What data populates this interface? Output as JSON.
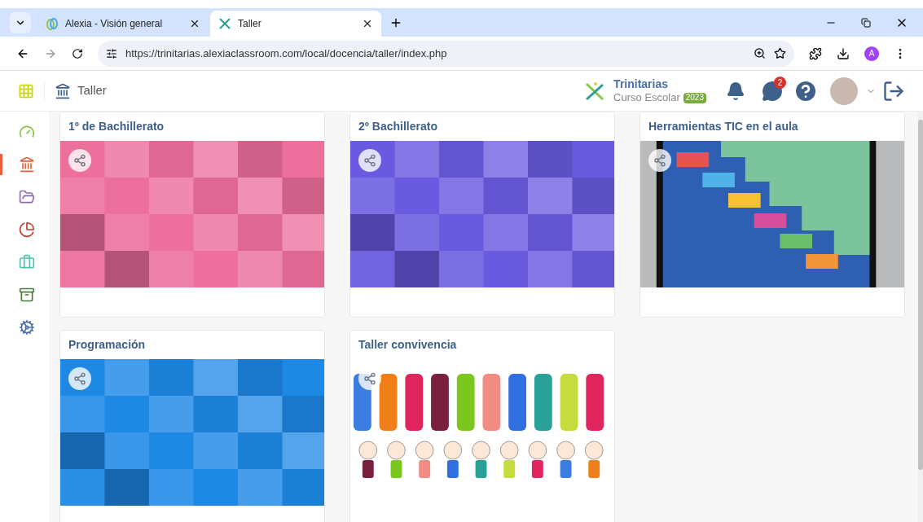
{
  "browser": {
    "tabs": [
      {
        "title": "Alexia - Visión general",
        "selected": false
      },
      {
        "title": "Taller",
        "selected": true
      }
    ],
    "url": "https://trinitarias.alexiaclassroom.com/local/docencia/taller/index.php",
    "profile": "A"
  },
  "header": {
    "title": "Taller",
    "brand": "Trinitarias",
    "subtitle": "Curso Escolar",
    "year": "2023",
    "messages": "2"
  },
  "sidebar": {
    "items": [
      {
        "selected": false
      },
      {
        "selected": true
      },
      {
        "selected": false
      },
      {
        "selected": false
      },
      {
        "selected": false
      },
      {
        "selected": false
      },
      {
        "selected": false
      }
    ]
  },
  "courses": [
    {
      "title": "1º de Bachillerato",
      "kind": "picture"
    },
    {
      "title": "2º Bachillerato",
      "kind": "picture"
    },
    {
      "title": "Herramientas TIC en el aula",
      "kind": "picture"
    },
    {
      "title": "Programación",
      "kind": "picture"
    },
    {
      "title": "Taller convivencia",
      "kind": "picture"
    }
  ]
}
